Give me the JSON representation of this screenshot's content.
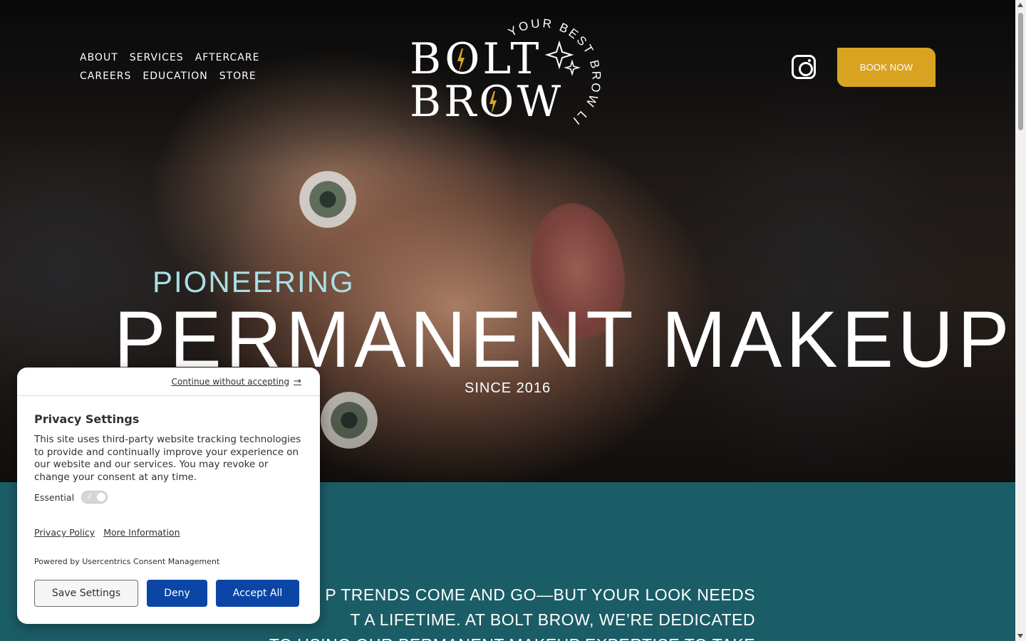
{
  "nav": {
    "items": [
      "ABOUT",
      "SERVICES",
      "AFTERCARE",
      "CAREERS",
      "EDUCATION",
      "STORE"
    ]
  },
  "logo": {
    "line1": "BOLT",
    "line2": "BROW",
    "tagline": "YOUR BEST BROW LIFE"
  },
  "header": {
    "book_label": "BOOK NOW",
    "instagram_icon": "instagram-icon"
  },
  "hero": {
    "eyebrow": "PIONEERING",
    "headline": "PERMANENT MAKEUP",
    "since": "SINCE 2016"
  },
  "teal": {
    "text_line1": "P TRENDS COME AND GO—BUT YOUR LOOK NEEDS",
    "text_line2": "T A LIFETIME.  AT BOLT BROW, WE’RE DEDICATED",
    "text_line3": "TO USING OUR PERMANENT MAKEUP EXPERTISE TO TAKE"
  },
  "consent": {
    "continue_label": "Continue without accepting",
    "title": "Privacy Settings",
    "body": "This site uses third-party website tracking technologies to provide and continually improve your experience on our website and our services. You may revoke or change your consent at any time.",
    "essential_label": "Essential",
    "privacy_policy": "Privacy Policy",
    "more_info": "More Information",
    "powered_by": "Powered by Usercentrics Consent Management",
    "save_label": "Save Settings",
    "deny_label": "Deny",
    "accept_label": "Accept All"
  },
  "colors": {
    "accent_gold": "#d8a321",
    "teal_section": "#1b5d66",
    "eyebrow_cyan": "#a9dfe4",
    "consent_blue": "#0b45a5"
  }
}
